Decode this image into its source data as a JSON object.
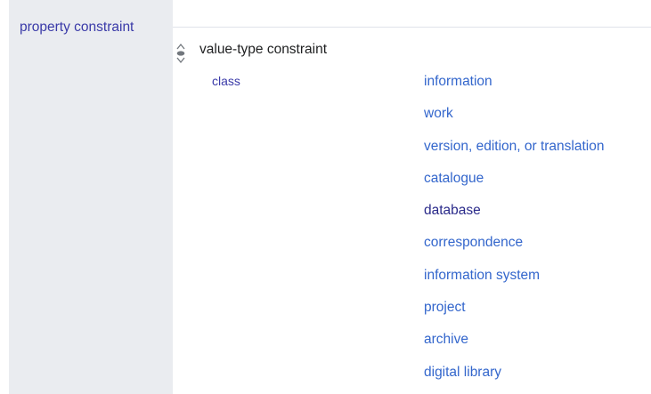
{
  "property": {
    "label": "property constraint"
  },
  "statement": {
    "rank_icon": "rank-normal-icon",
    "value": "value-type constraint",
    "qualifier": {
      "property": "class",
      "values": [
        {
          "label": "information",
          "visited": false
        },
        {
          "label": "work",
          "visited": false
        },
        {
          "label": "version, edition, or translation",
          "visited": false
        },
        {
          "label": "catalogue",
          "visited": false
        },
        {
          "label": "database",
          "visited": true
        },
        {
          "label": "correspondence",
          "visited": false
        },
        {
          "label": "information system",
          "visited": false
        },
        {
          "label": "project",
          "visited": false
        },
        {
          "label": "archive",
          "visited": false
        },
        {
          "label": "digital library",
          "visited": false
        }
      ]
    }
  },
  "colors": {
    "gutter_background": "#eaecf0",
    "link": "#3366cc",
    "visited_link": "#2a2a8a",
    "property_link": "#3a3aa8",
    "text": "#202122"
  }
}
